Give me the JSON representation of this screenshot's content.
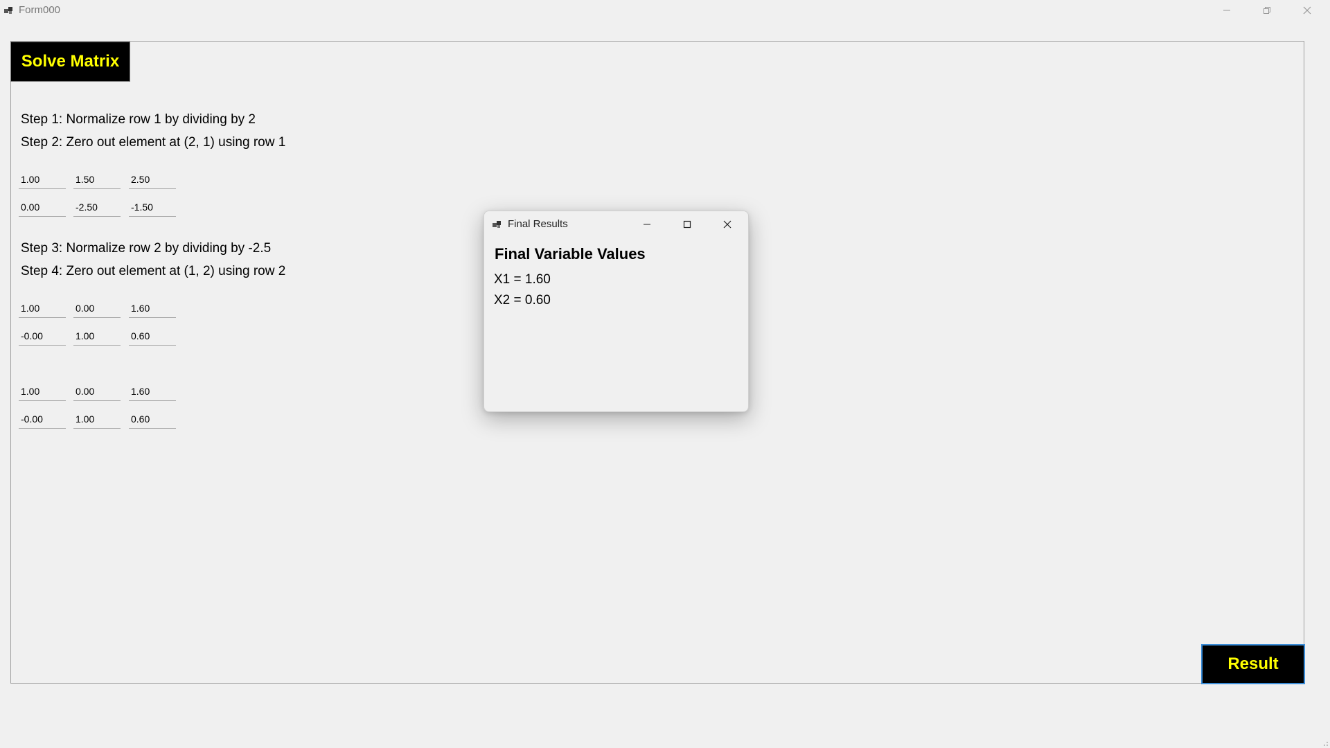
{
  "window": {
    "title": "Form000",
    "icon": "app-form-icon"
  },
  "main": {
    "solve_button": "Solve Matrix",
    "result_button": "Result",
    "steps": [
      "Step 1: Normalize row 1 by dividing by 2",
      "Step 2: Zero out element at (2, 1) using row 1",
      "Step 3: Normalize row 2 by dividing by -2.5",
      "Step 4: Zero out element at (1, 2) using row 2"
    ],
    "matrices": [
      {
        "rows": [
          [
            "1.00",
            "1.50",
            "2.50"
          ],
          [
            "0.00",
            "-2.50",
            "-1.50"
          ]
        ]
      },
      {
        "rows": [
          [
            "1.00",
            "0.00",
            "1.60"
          ],
          [
            "-0.00",
            "1.00",
            "0.60"
          ]
        ]
      },
      {
        "rows": [
          [
            "1.00",
            "0.00",
            "1.60"
          ],
          [
            "-0.00",
            "1.00",
            "0.60"
          ]
        ]
      }
    ]
  },
  "dialog": {
    "title": "Final Results",
    "heading": "Final Variable Values",
    "lines": [
      "X1 = 1.60",
      "X2 = 0.60"
    ]
  },
  "colors": {
    "button_bg": "#000000",
    "button_text": "#ffff00",
    "focus_border": "#3b8dd8",
    "window_bg": "#f0f0f0"
  }
}
